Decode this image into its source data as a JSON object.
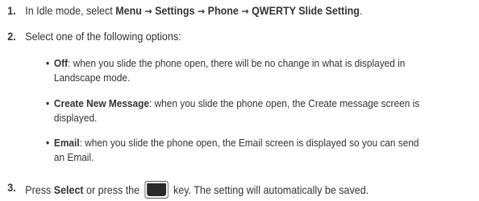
{
  "step1": {
    "number": "1.",
    "prefix": "In Idle mode, select ",
    "menu": "Menu",
    "settings": "Settings",
    "phone": "Phone",
    "qwerty": "QWERTY Slide Setting",
    "suffix": ".",
    "arrow_icon": "right-arrow"
  },
  "step2": {
    "number": "2.",
    "text": "Select one of the following options:"
  },
  "options": [
    {
      "name": "Off",
      "desc_line1": ": when you slide the phone open, there will be no change in what is displayed in",
      "desc_line2": "Landscape mode."
    },
    {
      "name": "Create New Message",
      "desc_line1": ": when you slide the phone open, the Create message screen is",
      "desc_line2": "displayed."
    },
    {
      "name": "Email",
      "desc_line1": ": when you slide the phone open, the Email screen is displayed so you can send",
      "desc_line2": "an Email."
    }
  ],
  "step3": {
    "number": "3.",
    "prefix": "Press ",
    "select": "Select",
    "middle": " or press the ",
    "key_icon": "center-select-key-icon",
    "suffix": " key. The setting will automatically be saved."
  }
}
